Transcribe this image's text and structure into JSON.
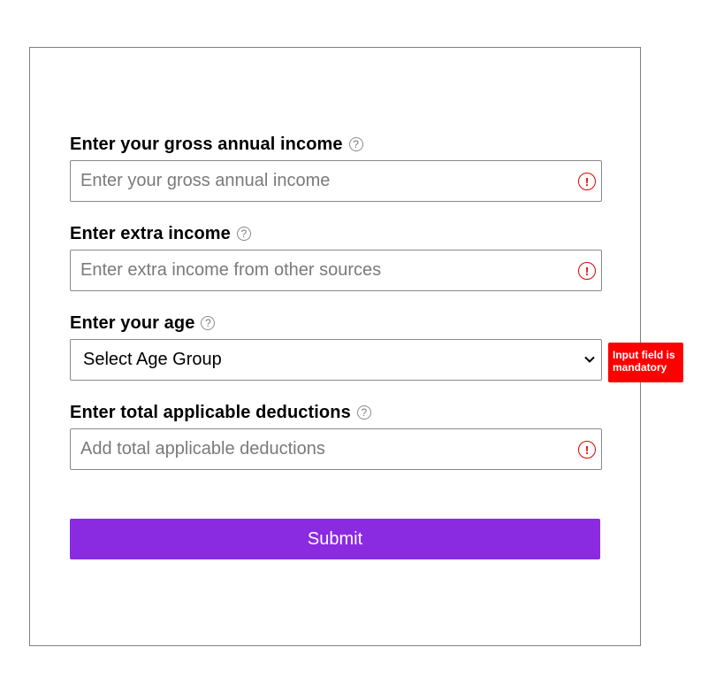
{
  "form": {
    "income": {
      "label": "Enter your gross annual income",
      "placeholder": "Enter your gross annual income",
      "help_glyph": "?",
      "error_glyph": "!"
    },
    "extra_income": {
      "label": "Enter extra income",
      "placeholder": "Enter extra income from other sources",
      "help_glyph": "?",
      "error_glyph": "!"
    },
    "age": {
      "label": "Enter your age",
      "selected": "Select Age Group",
      "help_glyph": "?",
      "tooltip": "Input field is mandatory"
    },
    "deductions": {
      "label": "Enter total applicable deductions",
      "placeholder": "Add total applicable deductions",
      "help_glyph": "?",
      "error_glyph": "!"
    },
    "submit_label": "Submit"
  },
  "colors": {
    "accent": "#8a2be2",
    "error": "#e00000",
    "tooltip_bg": "#ff0000",
    "border": "#8a8a8a"
  },
  "icons": {
    "help": "question-circle-icon",
    "error": "exclamation-circle-icon",
    "dropdown": "chevron-down-icon"
  }
}
